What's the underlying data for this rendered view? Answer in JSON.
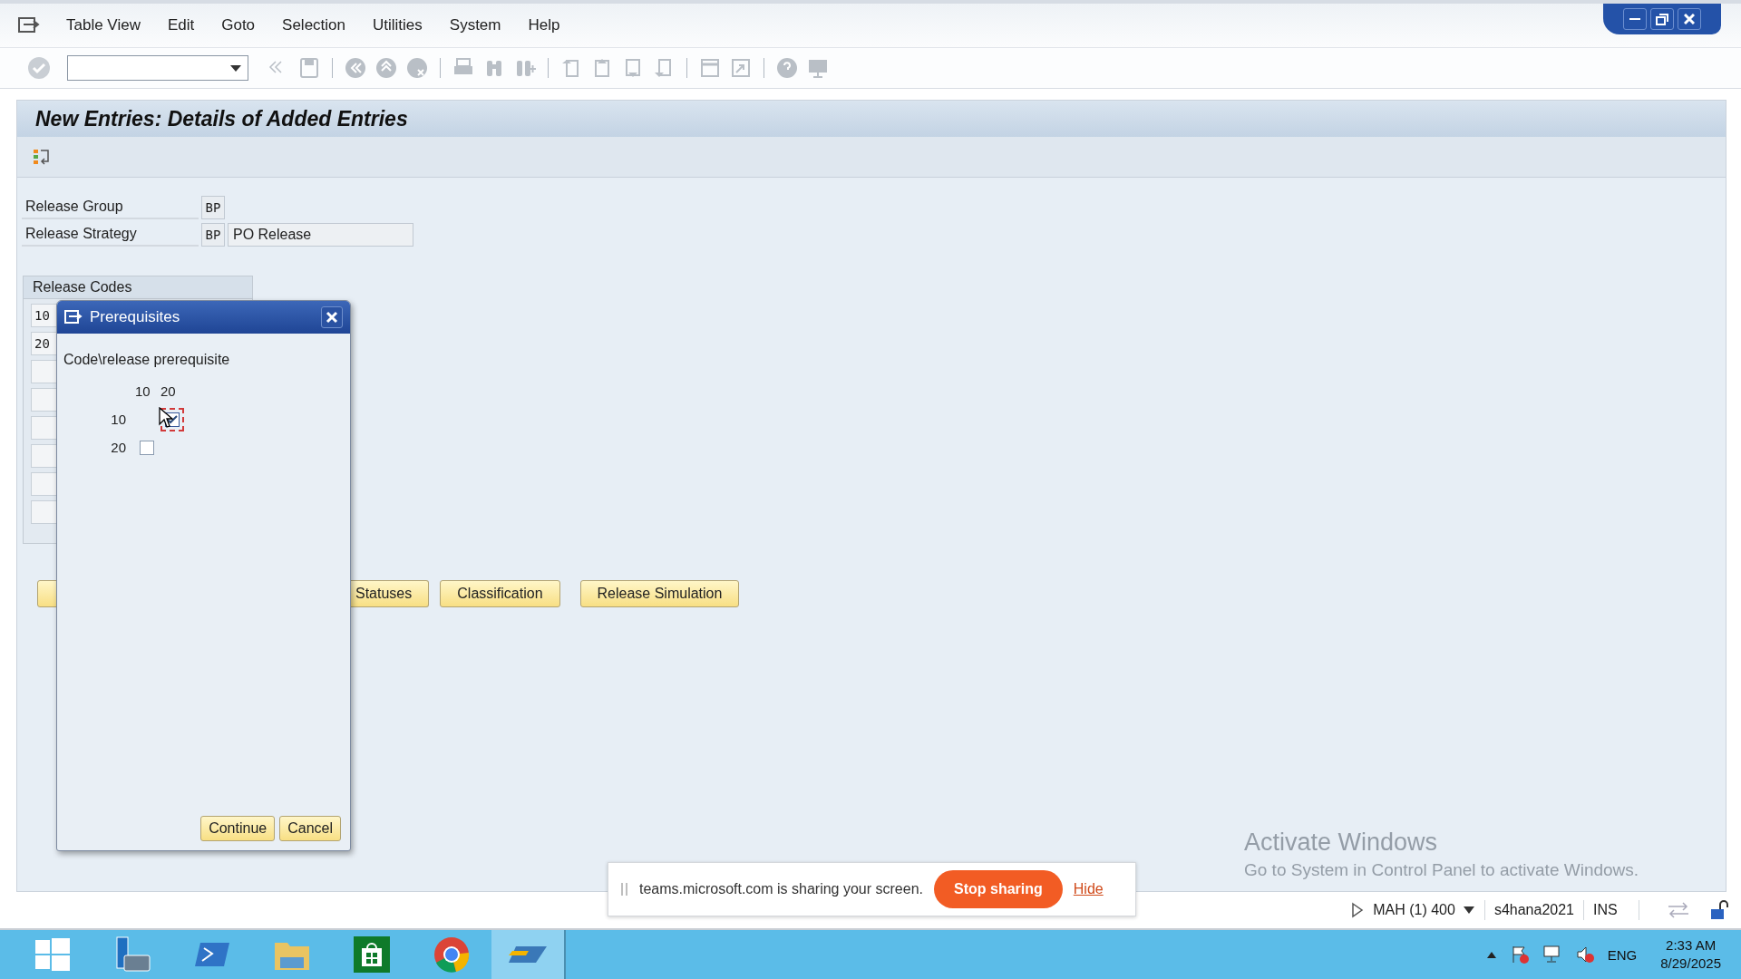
{
  "menu_bar": {
    "items": [
      "Table View",
      "Edit",
      "Goto",
      "Selection",
      "Utilities",
      "System",
      "Help"
    ]
  },
  "screen": {
    "title": "New Entries: Details of Added Entries",
    "fields": [
      {
        "label": "Release Group",
        "code": "BP"
      },
      {
        "label": "Release Strategy",
        "code": "BP",
        "description": "PO Release"
      }
    ],
    "release_codes": {
      "header": "Release Codes",
      "codes": [
        "10",
        "20"
      ]
    },
    "buttons": [
      "Statuses",
      "Classification",
      "Release Simulation"
    ]
  },
  "dialog": {
    "title": "Prerequisites",
    "heading": "Code\\release prerequisite",
    "columns": [
      "10",
      "20"
    ],
    "rows": [
      {
        "code": "10",
        "cells": [
          {
            "kind": "blank"
          },
          {
            "kind": "checkbox",
            "checked": true,
            "focused": true
          }
        ]
      },
      {
        "code": "20",
        "cells": [
          {
            "kind": "checkbox",
            "checked": false,
            "focused": false
          },
          {
            "kind": "blank"
          }
        ]
      }
    ],
    "buttons": [
      "Continue",
      "Cancel"
    ]
  },
  "screen_share": {
    "message": "teams.microsoft.com is sharing your screen.",
    "stop_button": "Stop sharing",
    "hide_link": "Hide"
  },
  "activation_notice": {
    "title": "Activate Windows",
    "message": "Go to System in Control Panel to activate Windows."
  },
  "status_bar": {
    "session": "MAH (1) 400",
    "server": "s4hana2021",
    "mode": "INS"
  },
  "taskbar": {
    "language": "ENG",
    "time": "2:33 AM",
    "date": "8/29/2025"
  }
}
